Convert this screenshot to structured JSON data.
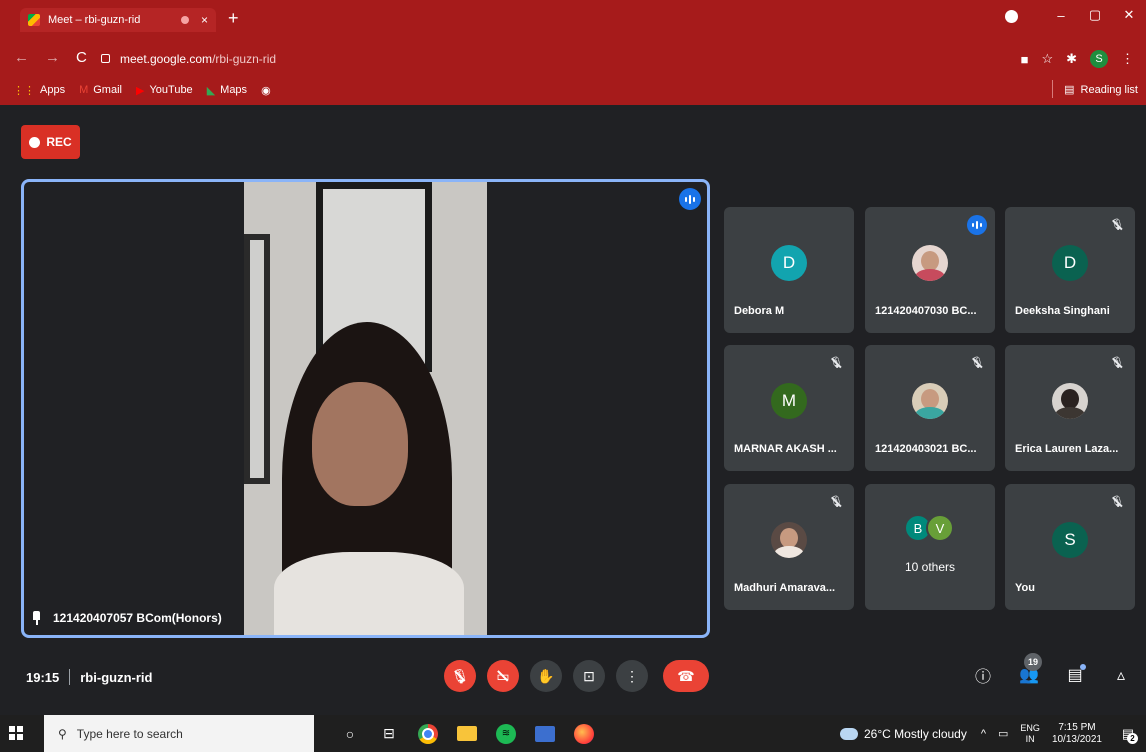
{
  "browser": {
    "tab_title": "Meet – rbi-guzn-rid",
    "tab_close": "×",
    "new_tab": "+",
    "nav": {
      "back": "←",
      "forward": "→",
      "reload": "C"
    },
    "url_domain": "meet.google.com",
    "url_path": "/rbi-guzn-rid",
    "window_controls": {
      "minimize": "–",
      "maximize": "▢",
      "close": "✕"
    },
    "profile_initial": "S",
    "bookmarks": [
      {
        "label": "Apps",
        "icon": "apps-grid-icon",
        "glyph": "⋮⋮",
        "color": "#fbbc05"
      },
      {
        "label": "Gmail",
        "icon": "gmail-icon",
        "glyph": "M",
        "color": "#ea4335"
      },
      {
        "label": "YouTube",
        "icon": "youtube-icon",
        "glyph": "▶",
        "color": "#ff0000"
      },
      {
        "label": "Maps",
        "icon": "maps-icon",
        "glyph": "◣",
        "color": "#34a853"
      }
    ],
    "reading_list_label": "Reading list"
  },
  "meet": {
    "rec_label": "REC",
    "main_participant": "121420407057 BCom(Honors)",
    "participants": [
      {
        "name": "Debora M",
        "initial": "D",
        "color": "#12a4af",
        "status": "none"
      },
      {
        "name": "121420407030 BC...",
        "photo": "p2",
        "status": "speaking"
      },
      {
        "name": "Deeksha Singhani",
        "initial": "D",
        "color": "#0a6250",
        "status": "muted"
      },
      {
        "name": "MARNAR AKASH ...",
        "initial": "M",
        "color": "#33691e",
        "status": "muted"
      },
      {
        "name": "121420403021 BC...",
        "photo": "p4",
        "status": "muted"
      },
      {
        "name": "Erica Lauren Laza...",
        "photo": "p3",
        "status": "muted"
      },
      {
        "name": "Madhuri Amarava...",
        "photo": "p1",
        "status": "muted"
      },
      {
        "others_label": "10 others",
        "stack": [
          {
            "initial": "B",
            "color": "#00897b"
          },
          {
            "initial": "V",
            "color": "#689f38"
          }
        ]
      },
      {
        "name": "You",
        "initial": "S",
        "color": "#0a6250",
        "status": "muted"
      }
    ],
    "time": "19:15",
    "meeting_code": "rbi-guzn-rid",
    "participant_count": "19",
    "controls": [
      "mic-off",
      "camera-off",
      "raise-hand",
      "present",
      "more-options",
      "leave-call"
    ]
  },
  "taskbar": {
    "search_placeholder": "Type here to search",
    "weather": "26°C  Mostly cloudy",
    "lang_top": "ENG",
    "lang_bottom": "IN",
    "clock_time": "7:15 PM",
    "clock_date": "10/13/2021",
    "notification_count": "2"
  }
}
